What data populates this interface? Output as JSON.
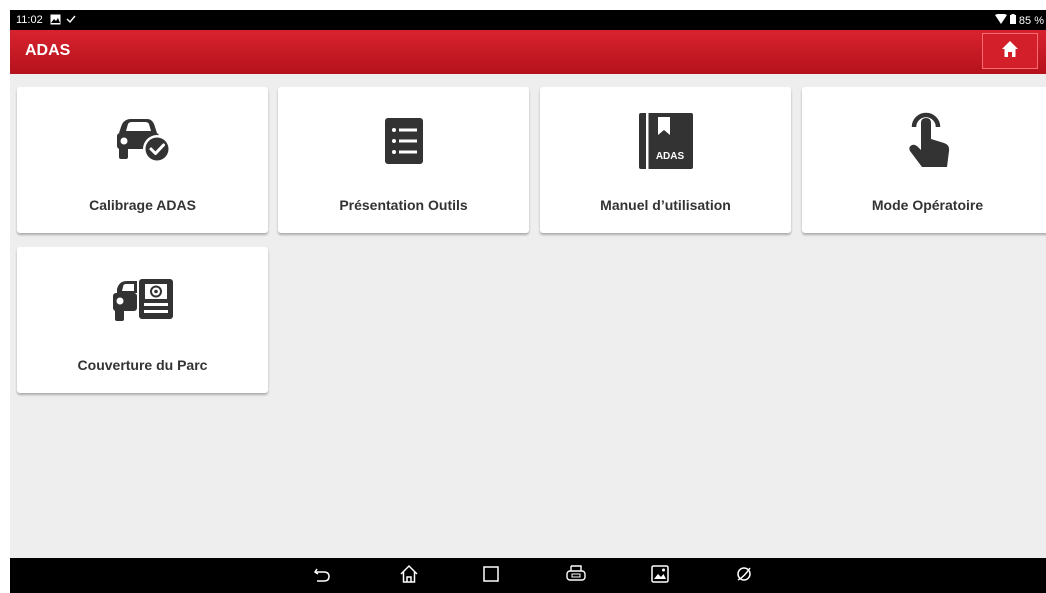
{
  "status_bar": {
    "time": "11:02",
    "battery": "85 %"
  },
  "app_bar": {
    "title": "ADAS",
    "home_icon": "home-icon",
    "accent_color": "#c8161f"
  },
  "tiles": [
    {
      "label": "Calibrage ADAS",
      "icon": "car-check-icon"
    },
    {
      "label": "Présentation Outils",
      "icon": "list-icon"
    },
    {
      "label": "Manuel d’utilisation",
      "icon": "manual-book-icon",
      "icon_text": "ADAS"
    },
    {
      "label": "Mode Opératoire",
      "icon": "touch-hand-icon"
    },
    {
      "label": "Couverture du Parc",
      "icon": "car-card-icon"
    }
  ],
  "nav_bar": [
    "back-icon",
    "home-icon",
    "recents-icon",
    "vci-icon",
    "gallery-icon",
    "browser-icon"
  ]
}
